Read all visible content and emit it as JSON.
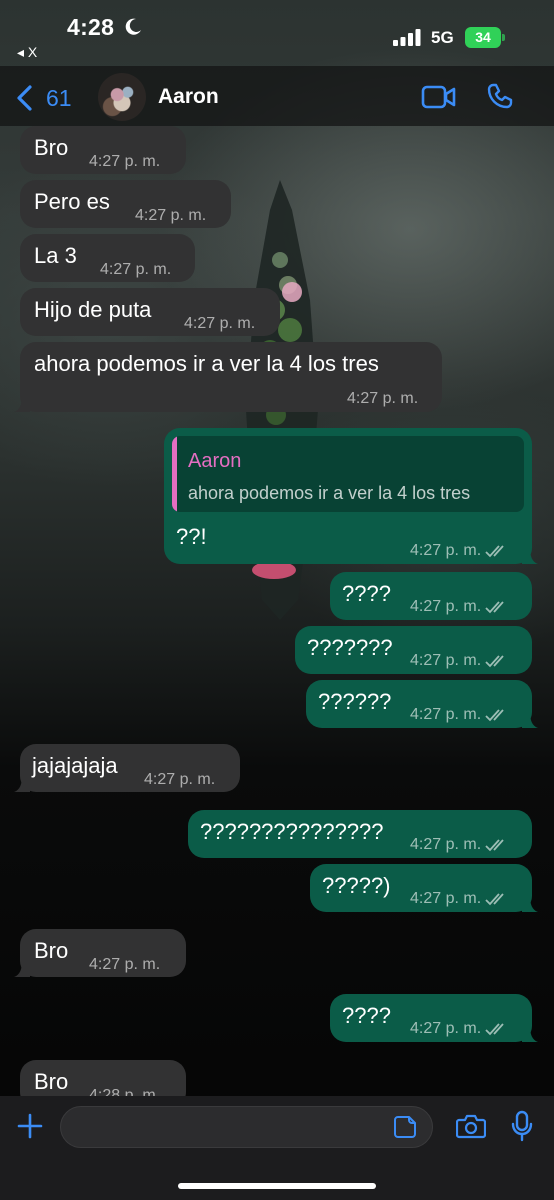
{
  "status_bar": {
    "time": "4:28",
    "back_app": "◂ X",
    "network": "5G",
    "battery": "34"
  },
  "header": {
    "back_count": "61",
    "contact_name": "Aaron"
  },
  "messages": [
    {
      "dir": "in",
      "text": "Bro",
      "time": "4:27 p. m."
    },
    {
      "dir": "in",
      "text": "Pero es",
      "time": "4:27 p. m."
    },
    {
      "dir": "in",
      "text": "La 3",
      "time": "4:27 p. m."
    },
    {
      "dir": "in",
      "text": "Hijo de puta",
      "time": "4:27 p. m."
    },
    {
      "dir": "in",
      "text": "ahora podemos ir a ver la 4 los tres",
      "time": "4:27 p. m."
    },
    {
      "dir": "out",
      "text": "??!",
      "time": "4:27 p. m.",
      "quote_name": "Aaron",
      "quote_text": "ahora podemos ir a ver la 4 los tres"
    },
    {
      "dir": "out",
      "text": "????",
      "time": "4:27 p. m."
    },
    {
      "dir": "out",
      "text": "???????",
      "time": "4:27 p. m."
    },
    {
      "dir": "out",
      "text": "??????",
      "time": "4:27 p. m."
    },
    {
      "dir": "in",
      "text": "jajajajaja",
      "time": "4:27 p. m."
    },
    {
      "dir": "out",
      "text": "???????????????",
      "time": "4:27 p. m."
    },
    {
      "dir": "out",
      "text": "?????)",
      "time": "4:27 p. m."
    },
    {
      "dir": "in",
      "text": "Bro",
      "time": "4:27 p. m."
    },
    {
      "dir": "out",
      "text": "????",
      "time": "4:27 p. m."
    },
    {
      "dir": "in",
      "text": "Bro",
      "time": "4:28 p. m."
    }
  ],
  "composer": {
    "input_value": ""
  },
  "colors": {
    "accent": "#3b8cf5",
    "outgoing_bubble": "#0b5c48",
    "incoming_bubble": "#323233",
    "quote_name": "#e46ec2",
    "battery": "#30d158"
  }
}
